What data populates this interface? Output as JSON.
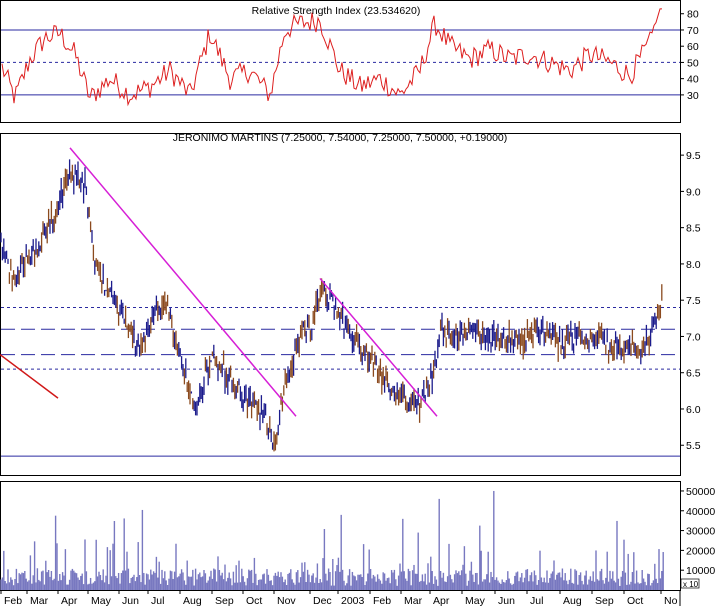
{
  "chart_data": [
    {
      "panel": "rsi",
      "type": "line",
      "title": "Relative Strength Index (23.534620)",
      "yticks": [
        "30",
        "40",
        "50",
        "60",
        "70",
        "80"
      ],
      "ylim": [
        17,
        86
      ],
      "levels": [
        30,
        50,
        70
      ],
      "last_value": 83,
      "colors": {
        "line": "#dd1f1f",
        "levels": "#2a2aa0"
      }
    },
    {
      "panel": "price",
      "type": "candlestick",
      "title": "JERONIMO MARTINS (7.25000, 7.54000, 7.25000, 7.50000, +0.19000)",
      "ohlc_last": {
        "open": 7.25,
        "high": 7.54,
        "low": 7.25,
        "close": 7.5,
        "change": 0.19
      },
      "yticks": [
        "5.5",
        "6.0",
        "6.5",
        "7.0",
        "7.5",
        "8.0",
        "8.5",
        "9.0",
        "9.5"
      ],
      "ylim": [
        5.2,
        9.75
      ],
      "horizontal_levels": [
        5.35,
        6.55,
        6.75,
        7.1,
        7.4
      ],
      "trendlines": [
        {
          "from": [
            "2002-04",
            9.6
          ],
          "to": [
            "2002-11",
            5.9
          ],
          "color": "#d61fd6"
        },
        {
          "from": [
            "2002-12",
            7.8
          ],
          "to": [
            "2003-03",
            5.9
          ],
          "color": "#d61fd6"
        },
        {
          "from": [
            "2002-02",
            6.75
          ],
          "to": [
            "2002-04",
            6.15
          ],
          "color": "#d01818"
        }
      ],
      "colors": {
        "up": "#1c1c8c",
        "down": "#8b4a1e"
      }
    },
    {
      "panel": "volume",
      "type": "bar",
      "yticks": [
        "10000",
        "20000",
        "30000",
        "40000",
        "50000"
      ],
      "ylim": [
        0,
        52000
      ],
      "scale_label": "x 10",
      "colors": {
        "bars": "#7878c0"
      }
    }
  ],
  "x_axis": {
    "labels": [
      "Feb",
      "Mar",
      "Apr",
      "May",
      "Jun",
      "Jul",
      "Aug",
      "Sep",
      "Oct",
      "Nov",
      "Dec",
      "2003",
      "Feb",
      "Mar",
      "Apr",
      "May",
      "Jun",
      "Jul",
      "Aug",
      "Sep",
      "Oct",
      "No"
    ]
  }
}
